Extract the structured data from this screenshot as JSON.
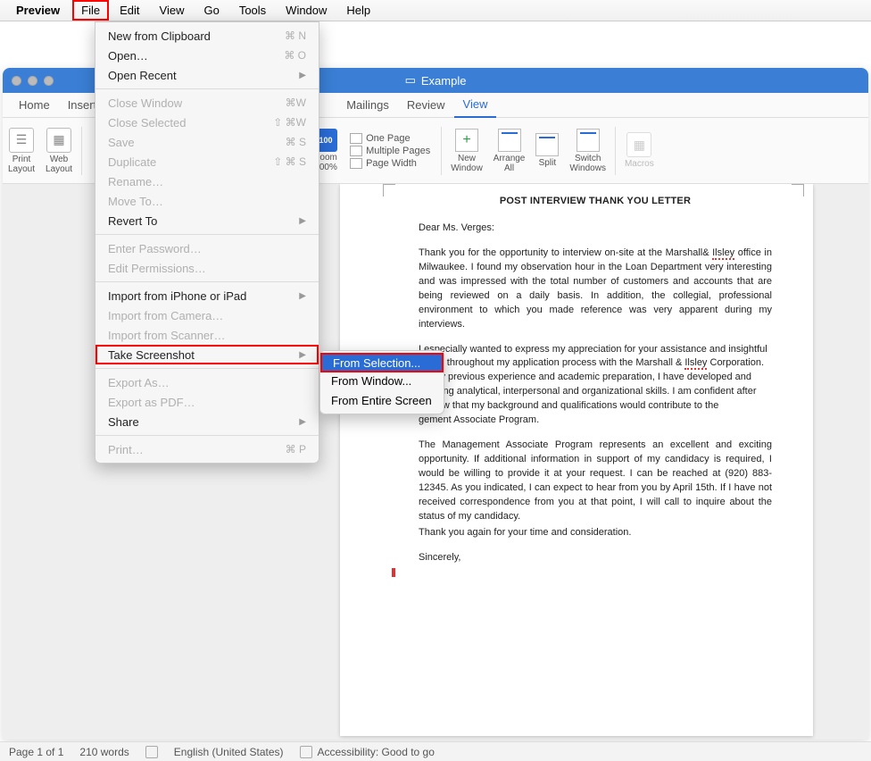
{
  "menubar": {
    "app": "Preview",
    "items": [
      "File",
      "Edit",
      "View",
      "Go",
      "Tools",
      "Window",
      "Help"
    ]
  },
  "file_menu": {
    "new_from_clipboard": "New from Clipboard",
    "new_from_clipboard_sc": "⌘ N",
    "open": "Open…",
    "open_sc": "⌘ O",
    "open_recent": "Open Recent",
    "close_window": "Close Window",
    "close_window_sc": "⌘W",
    "close_selected": "Close Selected",
    "close_selected_sc": "⇧ ⌘W",
    "save": "Save",
    "save_sc": "⌘ S",
    "duplicate": "Duplicate",
    "duplicate_sc": "⇧ ⌘ S",
    "rename": "Rename…",
    "move_to": "Move To…",
    "revert_to": "Revert To",
    "enter_password": "Enter Password…",
    "edit_permissions": "Edit Permissions…",
    "import_iphone": "Import from iPhone or iPad",
    "import_camera": "Import from Camera…",
    "import_scanner": "Import from Scanner…",
    "take_screenshot": "Take Screenshot",
    "export_as": "Export As…",
    "export_pdf": "Export as PDF…",
    "share": "Share",
    "print": "Print…",
    "print_sc": "⌘ P"
  },
  "screenshot_submenu": {
    "from_selection": "From Selection...",
    "from_window": "From Window...",
    "from_entire": "From Entire Screen"
  },
  "window": {
    "title": "Example"
  },
  "tabs": [
    "Home",
    "Insert",
    "Mailings",
    "Review",
    "View"
  ],
  "ribbon": {
    "print_layout": "Print\nLayout",
    "web_layout": "Web\nLayout",
    "zoom": "Zoom",
    "zoom_pct": "100%",
    "zoom_badge": "100",
    "one_page": "One Page",
    "multiple_pages": "Multiple Pages",
    "page_width": "Page Width",
    "new_window": "New\nWindow",
    "arrange_all": "Arrange\nAll",
    "split": "Split",
    "switch_windows": "Switch\nWindows",
    "macros": "Macros"
  },
  "document": {
    "title": "POST INTERVIEW THANK YOU LETTER",
    "salutation": "Dear Ms. Verges:",
    "p1a": "Thank you for the opportunity to interview on-site at the Marshall& ",
    "p1_spell": "Ilsley",
    "p1b": " office in Milwaukee. I found my observation hour in the Loan Department very interesting and was impressed with the total number of customers and accounts that are being reviewed on a daily basis. In addition, the collegial, professional environment to which you made reference was very apparent during my interviews.",
    "p2a": "I especially wanted to express my appreciation for your assistance and insightful",
    "p2b": "stions throughout my application process with the Marshall & ",
    "p2_spell": "Ilsley",
    "p2c": " Corporation.",
    "p2d": "gh my previous experience and academic preparation, I have developed and",
    "p2e": "d strong analytical, interpersonal and organizational skills. I am confident after",
    "p2f": "terview that my background and qualifications would contribute to the",
    "p2g": "gement Associate Program.",
    "p3": "The Management Associate Program represents an excellent and exciting opportunity. If additional information in support of my candidacy is required, I would be willing to provide it at your request. I can be reached at (920) 883-12345. As you indicated, I can expect to hear from you by April 15th. If I have not received correspondence from you at that point, I will call to inquire about the status of my candidacy.",
    "p4": "Thank you again for your time and consideration.",
    "closing": "Sincerely,"
  },
  "statusbar": {
    "page": "Page 1 of 1",
    "words": "210 words",
    "lang": "English (United States)",
    "accessibility": "Accessibility: Good to go"
  }
}
